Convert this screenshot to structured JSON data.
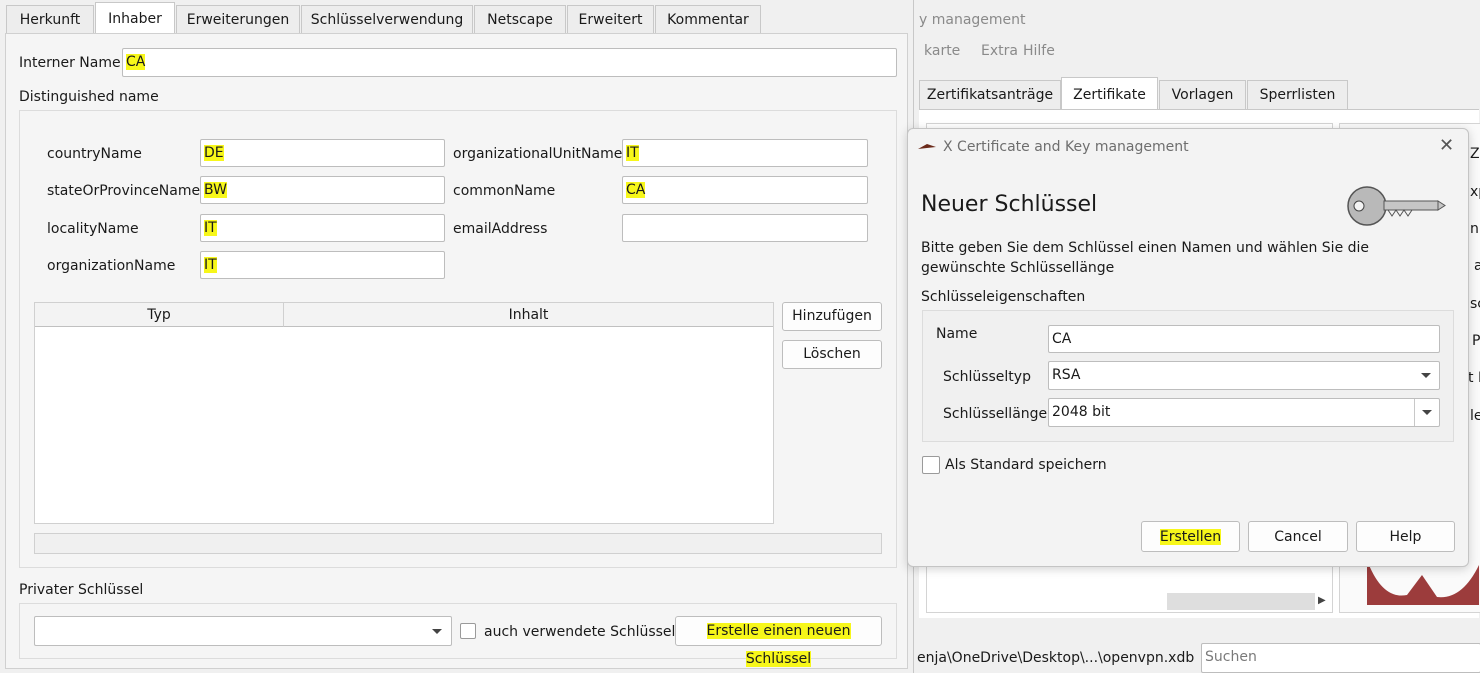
{
  "background_window": {
    "title": "y management",
    "menu": [
      "karte",
      "Extra",
      "Hilfe"
    ],
    "tabs": [
      "Zertifikatsanträge",
      "Zertifikate",
      "Vorlagen",
      "Sperrlisten"
    ],
    "active_tab": "Zertifikate",
    "side_fragments": [
      "Ze",
      "xp",
      "np",
      "a",
      "sc",
      "P",
      "t P",
      "le"
    ],
    "status_path": "enja\\OneDrive\\Desktop\\...\\openvpn.xdb",
    "search_placeholder": "Suchen"
  },
  "left_panel": {
    "tabs": [
      "Herkunft",
      "Inhaber",
      "Erweiterungen",
      "Schlüsselverwendung",
      "Netscape",
      "Erweitert",
      "Kommentar"
    ],
    "active_tab": "Inhaber",
    "internal_name_label": "Interner Name",
    "internal_name_value": "CA",
    "dn_heading": "Distinguished name",
    "fields": {
      "countryName": {
        "label": "countryName",
        "value": "DE"
      },
      "stateOrProvinceName": {
        "label": "stateOrProvinceName",
        "value": "BW"
      },
      "localityName": {
        "label": "localityName",
        "value": "IT"
      },
      "organizationName": {
        "label": "organizationName",
        "value": "IT"
      },
      "organizationalUnitName": {
        "label": "organizationalUnitName",
        "value": "IT"
      },
      "commonName": {
        "label": "commonName",
        "value": "CA"
      },
      "emailAddress": {
        "label": "emailAddress",
        "value": ""
      }
    },
    "table_headers": [
      "Typ",
      "Inhalt"
    ],
    "add_button": "Hinzufügen",
    "delete_button": "Löschen",
    "private_key_heading": "Privater Schlüssel",
    "private_key_select": "",
    "used_keys_checkbox": "auch verwendete Schlüssel",
    "create_key_button": "Erstelle einen neuen Schlüssel"
  },
  "dialog": {
    "title": "X Certificate and Key management",
    "heading": "Neuer Schlüssel",
    "description": "Bitte geben Sie dem Schlüssel einen Namen und wählen Sie die gewünschte Schlüssellänge",
    "props_heading": "Schlüsseleigenschaften",
    "name_label": "Name",
    "name_value": "CA",
    "type_label": "Schlüsseltyp",
    "type_value": "RSA",
    "length_label": "Schlüssellänge",
    "length_value": "2048 bit",
    "default_checkbox": "Als Standard speichern",
    "create_button": "Erstellen",
    "cancel_button": "Cancel",
    "help_button": "Help"
  },
  "colors": {
    "highlight": "#f7f71a",
    "window_bg": "#f0f0f0",
    "border": "#bdbdbd"
  }
}
